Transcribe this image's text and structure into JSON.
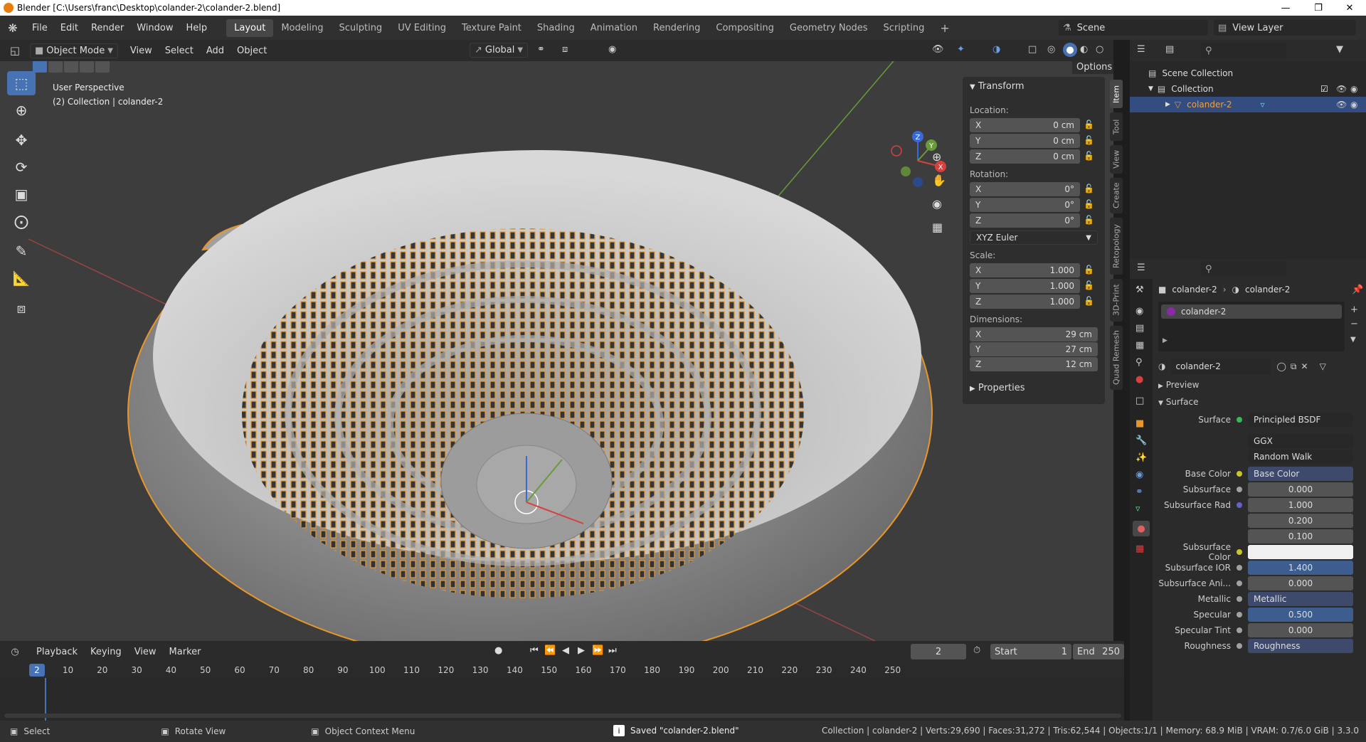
{
  "window": {
    "title": "Blender [C:\\Users\\franc\\Desktop\\colander-2\\colander-2.blend]"
  },
  "menu": [
    "File",
    "Edit",
    "Render",
    "Window",
    "Help"
  ],
  "workspaces": [
    "Layout",
    "Modeling",
    "Sculpting",
    "UV Editing",
    "Texture Paint",
    "Shading",
    "Animation",
    "Rendering",
    "Compositing",
    "Geometry Nodes",
    "Scripting"
  ],
  "workspace_add": "+",
  "scene": "Scene",
  "view_layer": "View Layer",
  "viewport_header": {
    "mode": "Object Mode",
    "menus": [
      "View",
      "Select",
      "Add",
      "Object"
    ],
    "transform_orientation": "Global",
    "options": "Options"
  },
  "viewport": {
    "view_name": "User Perspective",
    "collection_info": "(2) Collection | colander-2",
    "gizmo_axes": [
      "Z",
      "Y",
      "X"
    ]
  },
  "transform_panel": {
    "title": "Transform",
    "location_label": "Location:",
    "rotation_label": "Rotation:",
    "scale_label": "Scale:",
    "dimensions_label": "Dimensions:",
    "axes": [
      "X",
      "Y",
      "Z"
    ],
    "location": [
      "0 cm",
      "0 cm",
      "0 cm"
    ],
    "rotation": [
      "0°",
      "0°",
      "0°"
    ],
    "rotation_mode": "XYZ Euler",
    "scale": [
      "1.000",
      "1.000",
      "1.000"
    ],
    "dimensions": [
      "29 cm",
      "27 cm",
      "12 cm"
    ],
    "properties_label": "Properties"
  },
  "side_tabs": [
    "Item",
    "Tool",
    "View",
    "Create",
    "Retopology",
    "3D-Print",
    "Quad Remesh"
  ],
  "outliner": {
    "scene_collection": "Scene Collection",
    "collection": "Collection",
    "object": "colander-2"
  },
  "properties": {
    "breadcrumb_object": "colander-2",
    "breadcrumb_material": "colander-2",
    "material_slot": "colander-2",
    "material_name": "colander-2",
    "preview_label": "Preview",
    "surface_section": "Surface",
    "surface_label": "Surface",
    "surface_value": "Principled BSDF",
    "distribution": "GGX",
    "subsurface_method": "Random Walk",
    "rows": [
      {
        "label": "Base Color",
        "value": "Base Color",
        "kind": "node",
        "dot": "#c7c729"
      },
      {
        "label": "Subsurface",
        "value": "0.000",
        "kind": "num",
        "dot": "#a1a1a1"
      },
      {
        "label": "Subsurface Rad",
        "value": "1.000",
        "kind": "num",
        "dot": "#6363c7"
      },
      {
        "label": "",
        "value": "0.200",
        "kind": "num",
        "dot": ""
      },
      {
        "label": "",
        "value": "0.100",
        "kind": "num",
        "dot": ""
      },
      {
        "label": "Subsurface Color",
        "value": "",
        "kind": "color",
        "dot": "#c7c729"
      },
      {
        "label": "Subsurface IOR",
        "value": "1.400",
        "kind": "blue",
        "dot": "#a1a1a1"
      },
      {
        "label": "Subsurface Ani...",
        "value": "0.000",
        "kind": "num",
        "dot": "#a1a1a1"
      },
      {
        "label": "Metallic",
        "value": "Metallic",
        "kind": "node",
        "dot": "#a1a1a1"
      },
      {
        "label": "Specular",
        "value": "0.500",
        "kind": "blue",
        "dot": "#a1a1a1"
      },
      {
        "label": "Specular Tint",
        "value": "0.000",
        "kind": "num",
        "dot": "#a1a1a1"
      },
      {
        "label": "Roughness",
        "value": "Roughness",
        "kind": "node",
        "dot": "#a1a1a1"
      }
    ]
  },
  "timeline": {
    "menus": [
      "Playback",
      "Keying",
      "View",
      "Marker"
    ],
    "current_frame": "2",
    "start_label": "Start",
    "start": "1",
    "end_label": "End",
    "end": "250",
    "ticks": [
      "10",
      "20",
      "30",
      "40",
      "50",
      "60",
      "70",
      "80",
      "90",
      "100",
      "110",
      "120",
      "130",
      "140",
      "150",
      "160",
      "170",
      "180",
      "190",
      "200",
      "210",
      "220",
      "230",
      "240",
      "250"
    ]
  },
  "statusbar": {
    "select": "Select",
    "rotate": "Rotate View",
    "context": "Object Context Menu",
    "message": "Saved \"colander-2.blend\"",
    "stats": "Collection | colander-2 | Verts:29,690 | Faces:31,272 | Tris:62,544 | Objects:1/1 | Memory: 68.9 MiB | VRAM: 0.7/6.0 GiB | 3.3.0"
  },
  "colors": {
    "accent": "#4772b3",
    "selection": "#e8962a",
    "viewport_bg": "#3d3d3d"
  }
}
